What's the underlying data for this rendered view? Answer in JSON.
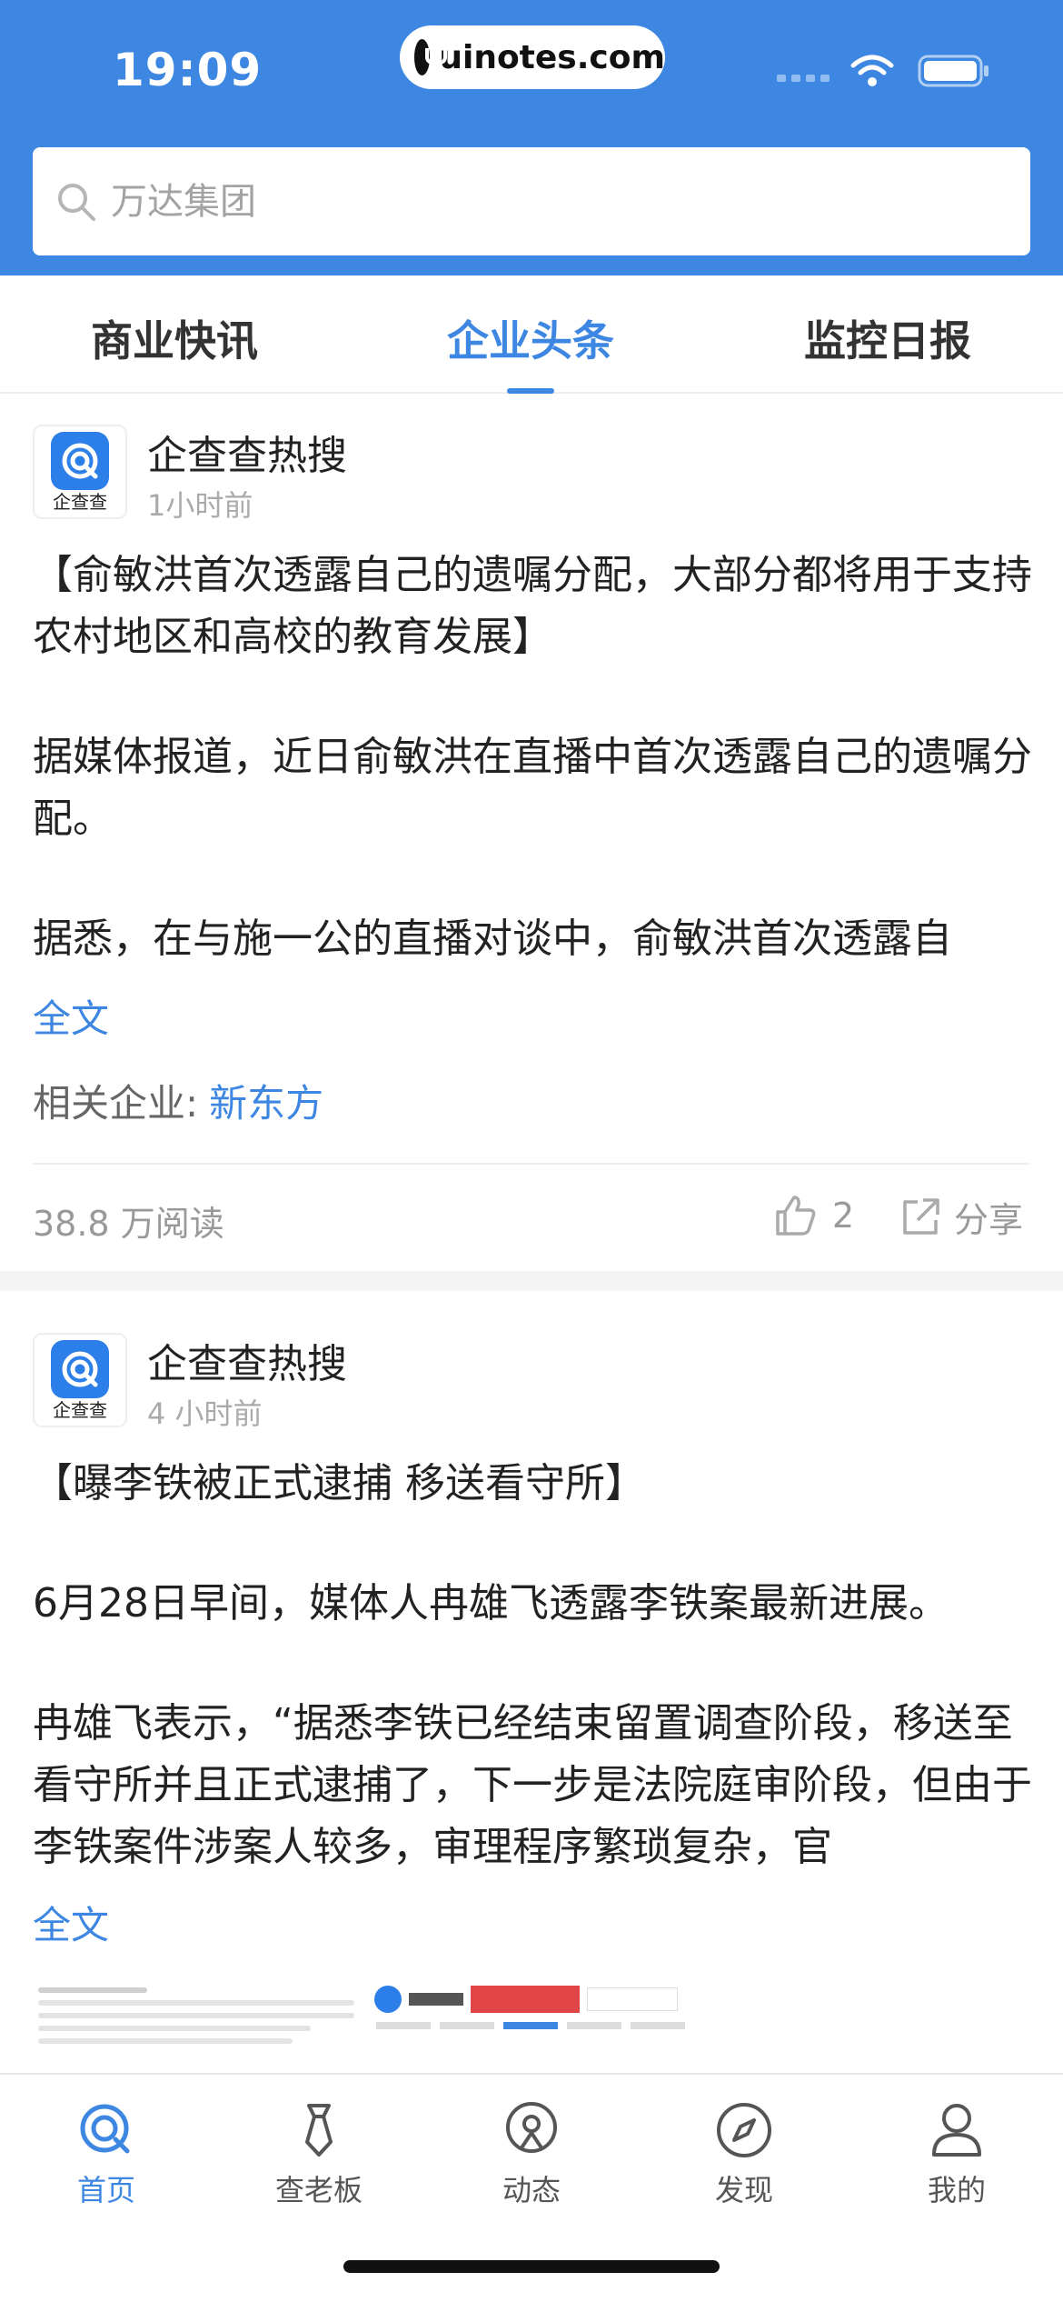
{
  "status_bar": {
    "time": "19:09",
    "url": "uinotes.com",
    "icons": [
      "signal-icon",
      "wifi-icon",
      "battery-icon"
    ]
  },
  "search": {
    "placeholder": "万达集团"
  },
  "tabs": [
    {
      "label": "商业快讯",
      "active": false
    },
    {
      "label": "企业头条",
      "active": true
    },
    {
      "label": "监控日报",
      "active": false
    }
  ],
  "feed": [
    {
      "author": "企查查热搜",
      "avatar_caption": "企查查",
      "time": "1小时前",
      "paragraphs": [
        "【俞敏洪首次透露自己的遗嘱分配，大部分都将用于支持农村地区和高校的教育发展】",
        "据媒体报道，近日俞敏洪在直播中首次透露自己的遗嘱分配。",
        "据悉，在与施一公的直播对谈中，俞敏洪首次透露自"
      ],
      "fulltext_label": "全文",
      "related_label": "相关企业:",
      "related_company": "新东方",
      "reads": "38.8 万阅读",
      "likes": "2",
      "share_label": "分享"
    },
    {
      "author": "企查查热搜",
      "avatar_caption": "企查查",
      "time": "4 小时前",
      "paragraphs": [
        "【曝李铁被正式逮捕 移送看守所】",
        "6月28日早间，媒体人冉雄飞透露李铁案最新进展。",
        "冉雄飞表示，“据悉李铁已经结束留置调查阶段，移送至看守所并且正式逮捕了，下一步是法院庭审阶段，但由于李铁案件涉案人较多，审理程序繁琐复杂，官"
      ],
      "fulltext_label": "全文"
    }
  ],
  "bottom_nav": [
    {
      "label": "首页",
      "icon": "home-q-icon",
      "active": true
    },
    {
      "label": "查老板",
      "icon": "tie-icon",
      "active": false
    },
    {
      "label": "动态",
      "icon": "broadcast-icon",
      "active": false
    },
    {
      "label": "发现",
      "icon": "compass-icon",
      "active": false
    },
    {
      "label": "我的",
      "icon": "user-icon",
      "active": false
    }
  ],
  "colors": {
    "brand_blue": "#3d87e2",
    "text": "#222222",
    "muted": "#999999"
  }
}
